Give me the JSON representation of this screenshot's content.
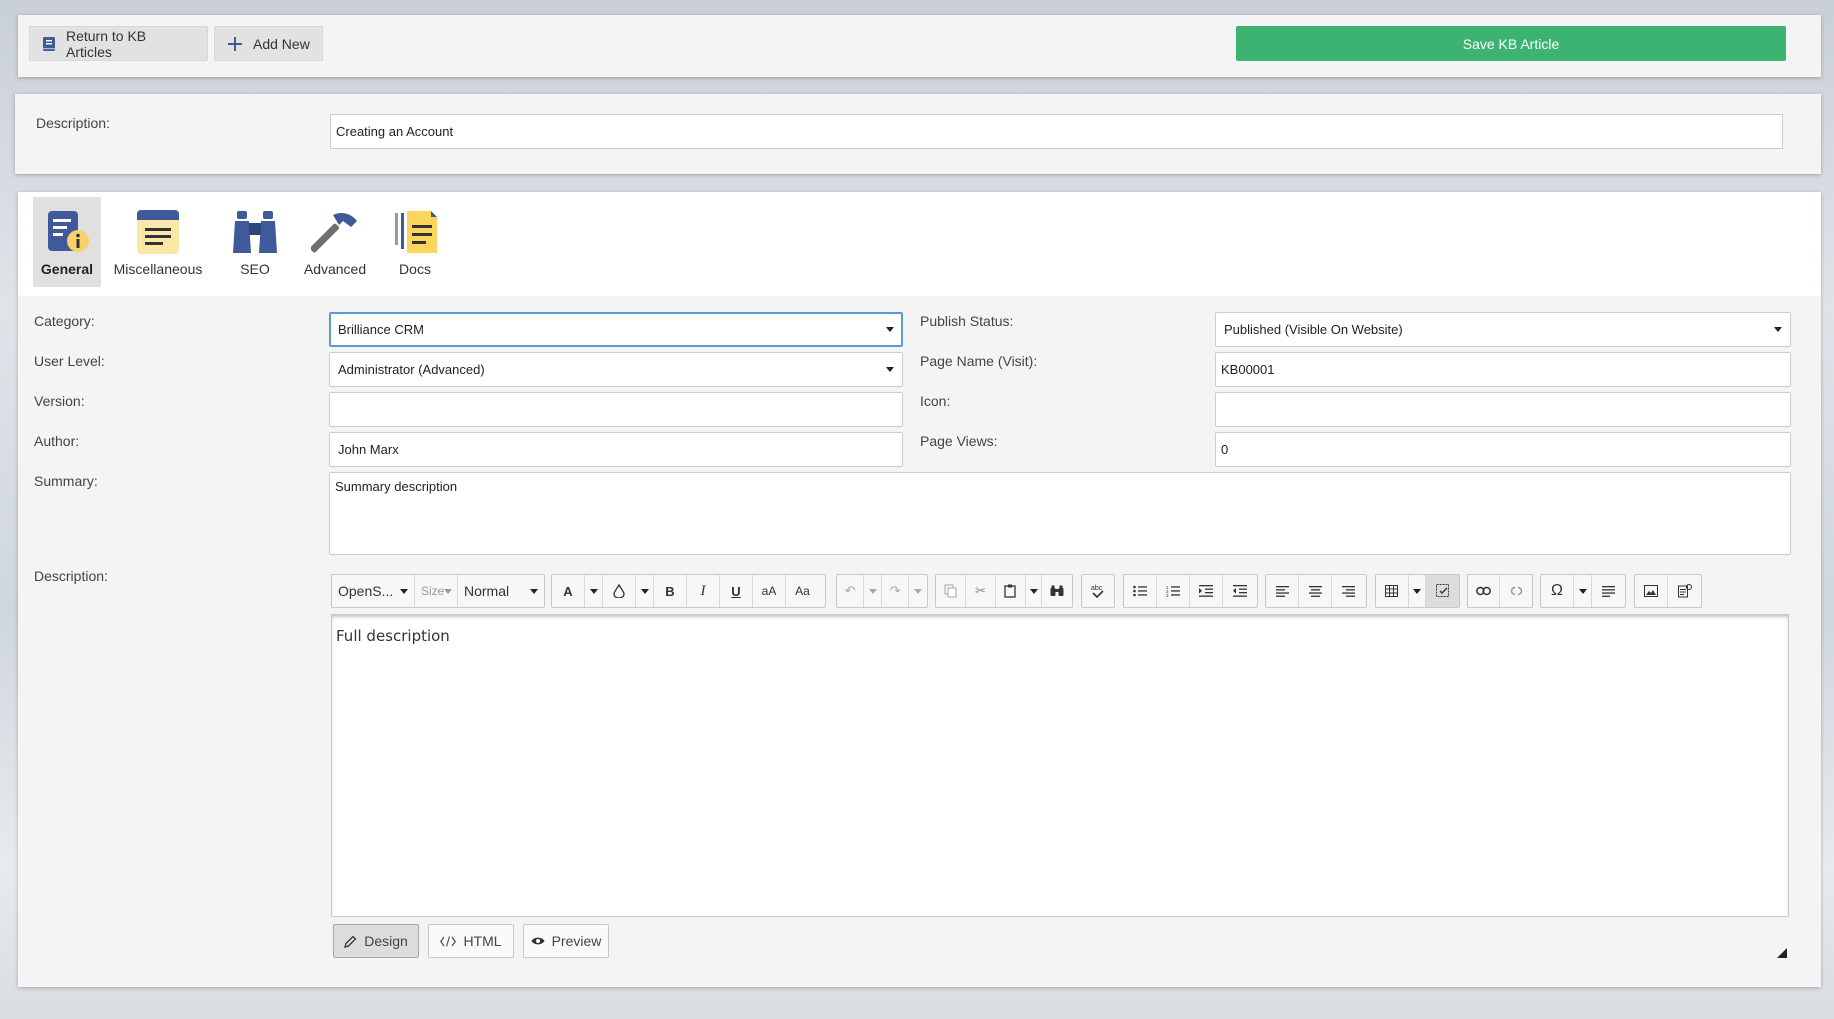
{
  "toolbar": {
    "return_label": "Return to KB Articles",
    "add_label": "Add New",
    "save_label": "Save KB Article",
    "save_color": "#3cb371"
  },
  "description": {
    "label": "Description:",
    "value": "Creating an Account"
  },
  "tabs": [
    {
      "label": "General",
      "icon": "general-info-icon",
      "active": true
    },
    {
      "label": "Miscellaneous",
      "icon": "notes-icon"
    },
    {
      "label": "SEO",
      "icon": "binoculars-icon"
    },
    {
      "label": "Advanced",
      "icon": "hammer-icon"
    },
    {
      "label": "Docs",
      "icon": "docs-icon"
    }
  ],
  "form": {
    "category": {
      "label": "Category:",
      "value": "Brilliance CRM"
    },
    "user_level": {
      "label": "User Level:",
      "value": "Administrator (Advanced)"
    },
    "version": {
      "label": "Version:",
      "value": ""
    },
    "author": {
      "label": "Author:",
      "value": "John Marx"
    },
    "summary": {
      "label": "Summary:",
      "value": "Summary description"
    },
    "publish_status": {
      "label": "Publish Status:",
      "value": "Published (Visible On Website)"
    },
    "page_name": {
      "label": "Page Name (Visit):",
      "value": "KB00001"
    },
    "icon": {
      "label": "Icon:",
      "value": ""
    },
    "page_views": {
      "label": "Page Views:",
      "value": "0"
    },
    "description_label": "Description:"
  },
  "editor": {
    "font": "OpenS...",
    "size": "Size",
    "format": "Normal",
    "content": "Full description",
    "modes": {
      "design": "Design",
      "html": "HTML",
      "preview": "Preview"
    }
  }
}
